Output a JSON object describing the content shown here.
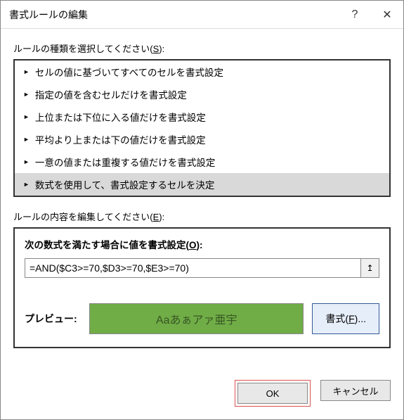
{
  "titlebar": {
    "title": "書式ルールの編集",
    "help": "?",
    "close": "✕"
  },
  "ruleTypeLabel": "ルールの種類を選択してください(",
  "ruleTypeAccel": "S",
  "ruleTypeLabelSuffix": "):",
  "ruleTypes": {
    "items": [
      {
        "label": "セルの値に基づいてすべてのセルを書式設定"
      },
      {
        "label": "指定の値を含むセルだけを書式設定"
      },
      {
        "label": "上位または下位に入る値だけを書式設定"
      },
      {
        "label": "平均より上または下の値だけを書式設定"
      },
      {
        "label": "一意の値または重複する値だけを書式設定"
      },
      {
        "label": "数式を使用して、書式設定するセルを決定"
      }
    ],
    "selectedIndex": 5
  },
  "ruleContentLabel": "ルールの内容を編集してください(",
  "ruleContentAccel": "E",
  "ruleContentLabelSuffix": "):",
  "formulaLabel": "次の数式を満たす場合に値を書式設定(",
  "formulaAccel": "O",
  "formulaLabelSuffix": "):",
  "formulaValue": "=AND($C3>=70,$D3>=70,$E3>=70)",
  "refIcon": "↥",
  "previewLabel": "プレビュー:",
  "previewText": "Aaあぁアァ亜宇",
  "formatBtnPrefix": "書式(",
  "formatBtnAccel": "F",
  "formatBtnSuffix": ")...",
  "buttons": {
    "ok": "OK",
    "cancel": "キャンセル"
  }
}
